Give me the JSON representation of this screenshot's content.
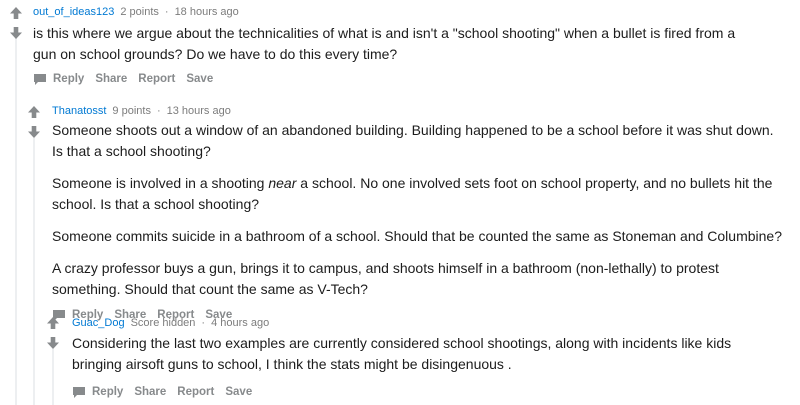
{
  "comments": [
    {
      "username": "out_of_ideas123",
      "points": "2 points",
      "time": "18 hours ago",
      "paragraphs": [
        "is this where we argue about the technicalities of what is and isn't a \"school shooting\" when a bullet is fired from a gun on school grounds? Do we have to do this every time?"
      ],
      "actions": [
        "Reply",
        "Share",
        "Report",
        "Save"
      ]
    },
    {
      "username": "Thanatosst",
      "points": "9 points",
      "time": "13 hours ago",
      "paragraphs": [
        "Someone shoots out a window of an abandoned building. Building happened to be a school before it was shut down. Is that a school shooting?",
        [
          "Someone is involved in a shooting ",
          "near",
          " a school. No one involved sets foot on school property, and no bullets hit the school. Is that a school shooting?"
        ],
        "Someone commits suicide in a bathroom of a school. Should that be counted the same as Stoneman and Columbine?",
        "A crazy professor buys a gun, brings it to campus, and shoots himself in a bathroom (non-lethally) to protest something. Should that count the same as V-Tech?"
      ],
      "actions": [
        "Reply",
        "Share",
        "Report",
        "Save"
      ]
    },
    {
      "username": "Guac_Dog",
      "points": "Score hidden",
      "time": "4 hours ago",
      "paragraphs": [
        "Considering the last two examples are currently considered school shootings, along with incidents like kids bringing airsoft guns to school, I think the stats might be disingenuous ."
      ],
      "actions": [
        "Reply",
        "Share",
        "Report",
        "Save"
      ]
    }
  ],
  "icons": {
    "upvote": "upvote-arrow-icon",
    "downvote": "downvote-arrow-icon",
    "reply": "chat-bubble-icon"
  },
  "colors": {
    "username": "#0079d3",
    "meta": "#7c7c7c",
    "action": "#878a8c",
    "arrow": "#878a8c",
    "thread_line": "#edeff1"
  }
}
